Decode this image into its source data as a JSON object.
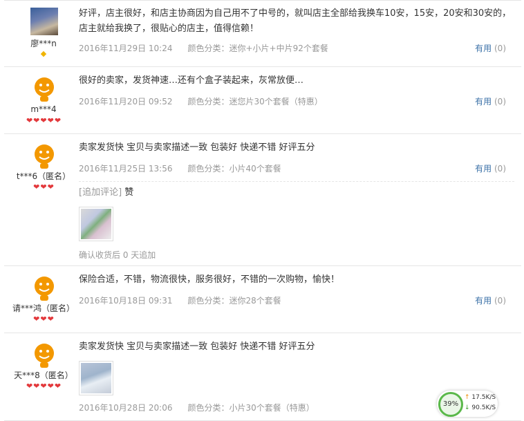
{
  "reviews": [
    {
      "nick": "廖***n",
      "content": "好评，店主很好，和店主协商因为自己用不了中号的，就叫店主全部给我换车10安，15安，20安和30安的，店主就给我换了，很贴心的店主，值得信赖！",
      "date": "2016年11月29日 10:24",
      "category": "颜色分类：迷你+小片+中片92个套餐",
      "useful_label": "有用",
      "useful_count": "(0)"
    },
    {
      "nick": "m***4",
      "content": "很好的卖家，发货神速…还有个盒子装起来，灰常放便…",
      "date": "2016年11月20日 09:52",
      "category": "颜色分类：迷您片30个套餐（特惠）",
      "useful_label": "有用",
      "useful_count": "(0)"
    },
    {
      "nick": "t***6（匿名）",
      "content": "卖家发货快 宝贝与卖家描述一致 包装好 快递不错 好评五分",
      "date": "2016年11月25日 13:56",
      "category": "颜色分类：小片40个套餐",
      "useful_label": "有用",
      "useful_count": "(0)",
      "append_label": "[追加评论]",
      "append_text": "赞",
      "append_note": "确认收货后 0 天追加"
    },
    {
      "nick": "请***鸿（匿名）",
      "content": "保险合适，不错，物流很快，服务很好，不错的一次购物，愉快！",
      "date": "2016年10月18日 09:31",
      "category": "颜色分类：迷你28个套餐",
      "useful_label": "有用",
      "useful_count": "(0)"
    },
    {
      "nick": "天***8（匿名）",
      "content": "卖家发货快 宝贝与卖家描述一致 包装好 快递不错 好评五分",
      "date": "2016年10月28日 20:06",
      "category": "颜色分类：小片30个套餐（特惠）"
    }
  ],
  "widget": {
    "percent": "39%",
    "upload": "17.5K/S",
    "download": "90.5K/S"
  },
  "colors": {
    "heart": "#e3393c",
    "link": "#3c72a8",
    "ring": "#5ab84a",
    "avatar": "#f39800"
  }
}
